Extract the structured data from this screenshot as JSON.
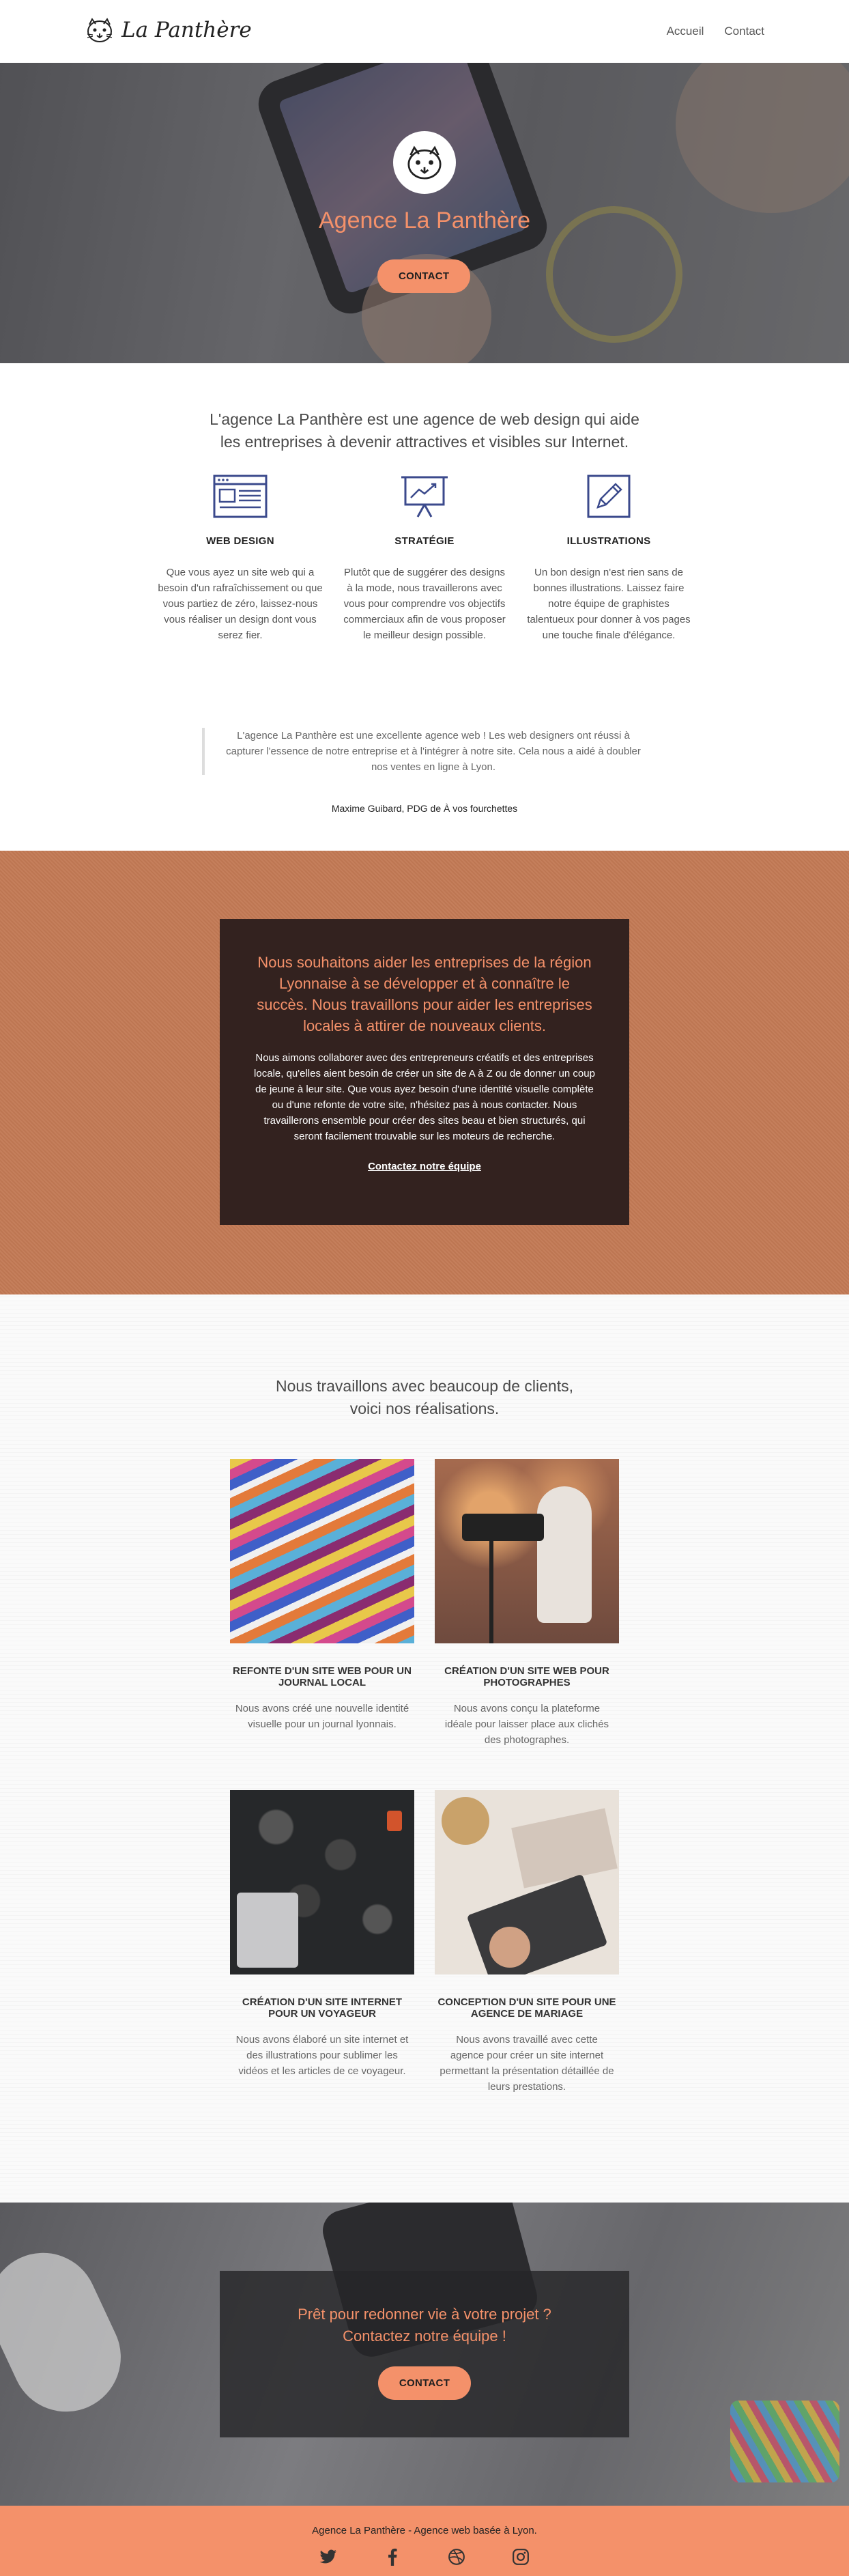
{
  "header": {
    "brand": "La Panthère",
    "nav": [
      "Accueil",
      "Contact"
    ]
  },
  "hero": {
    "title": "Agence La Panthère",
    "cta": "CONTACT"
  },
  "intro": {
    "line1": "L'agence La Panthère est une agence de web design qui aide",
    "line2": "les entreprises à devenir attractives et visibles sur Internet."
  },
  "features": [
    {
      "icon": "browser-window-icon",
      "title": "WEB DESIGN",
      "text": "Que vous ayez un site web qui a besoin d'un rafraîchissement ou que vous partiez de zéro, laissez-nous vous réaliser un design dont vous serez fier."
    },
    {
      "icon": "presentation-chart-icon",
      "title": "STRATÉGIE",
      "text": "Plutôt que de suggérer des designs à la mode, nous travaillerons avec vous pour comprendre vos objectifs commerciaux afin de vous proposer le meilleur design possible."
    },
    {
      "icon": "pencil-icon",
      "title": "ILLUSTRATIONS",
      "text": "Un bon design n'est rien sans de bonnes illustrations. Laissez faire notre équipe de graphistes talentueux pour donner à vos pages une touche finale d'élégance."
    }
  ],
  "testimonial": {
    "quote": "L'agence La Panthère est une excellente agence web ! Les web designers ont réussi à capturer l'essence de notre entreprise et à l'intégrer à notre site. Cela nous a aidé à doubler nos ventes en ligne à Lyon.",
    "author": "Maxime Guibard, PDG de À vos fourchettes"
  },
  "mission": {
    "heading": "Nous souhaitons aider les entreprises de la région Lyonnaise à se développer et à connaître le succès. Nous travaillons pour aider les entreprises locales à attirer de nouveaux clients.",
    "body": "Nous aimons collaborer avec des entrepreneurs créatifs et des entreprises locale, qu'elles aient besoin de créer un site de A à Z ou de donner un coup de jeune à leur site. Que vous ayez besoin d'une identité visuelle complète ou d'une refonte de votre site, n'hésitez pas à nous contacter. Nous travaillerons ensemble pour créer des sites beau et bien structurés, qui seront facilement trouvable sur les moteurs de recherche.",
    "link": "Contactez notre équipe"
  },
  "projects": {
    "title1": "Nous travaillons avec beaucoup de clients,",
    "title2": "voici nos réalisations.",
    "items": [
      {
        "title": "REFONTE D'UN SITE WEB POUR UN JOURNAL LOCAL",
        "text": "Nous avons créé une nouvelle identité visuelle pour un journal lyonnais."
      },
      {
        "title": "CRÉATION D'UN SITE WEB POUR PHOTOGRAPHES",
        "text": "Nous avons conçu la plateforme idéale pour laisser place aux clichés des photographes."
      },
      {
        "title": "CRÉATION D'UN SITE INTERNET POUR UN VOYAGEUR",
        "text": "Nous avons élaboré un site internet et des illustrations pour sublimer les vidéos et les articles de ce voyageur."
      },
      {
        "title": "CONCEPTION D'UN SITE POUR UNE AGENCE DE MARIAGE",
        "text": "Nous avons travaillé avec cette agence pour créer un site internet permettant la présentation détaillée de leurs prestations."
      }
    ]
  },
  "cta": {
    "line1": "Prêt pour redonner vie à votre projet ?",
    "line2": "Contactez notre équipe !",
    "button": "CONTACT"
  },
  "footer": {
    "text": "Agence La Panthère - Agence web basée à Lyon.",
    "socials": [
      "twitter-icon",
      "facebook-icon",
      "dribbble-icon",
      "instagram-icon"
    ]
  },
  "colors": {
    "accent": "#f4916a",
    "mission_bg": "#c37a55",
    "mission_box": "#33221f",
    "icon_blue": "#3b4a8c"
  }
}
